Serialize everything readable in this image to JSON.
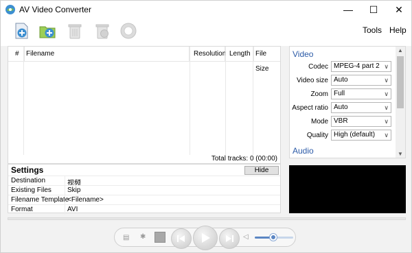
{
  "window": {
    "title": "AV Video Converter"
  },
  "menu": {
    "tools": "Tools",
    "help": "Help"
  },
  "toolbar": {
    "add_file": "add-file",
    "add_folder": "add-folder",
    "remove": "remove",
    "clear": "clear",
    "convert": "convert"
  },
  "filelist": {
    "columns": [
      "#",
      "Filename",
      "Resolution",
      "Length",
      "File Size"
    ],
    "total": "Total tracks: 0 (00:00)"
  },
  "settings": {
    "title": "Settings",
    "hide_label": "Hide",
    "rows": [
      {
        "key": "Destination",
        "value": "视频"
      },
      {
        "key": "Existing Files",
        "value": "Skip"
      },
      {
        "key": "Filename Template",
        "value": "<Filename>"
      },
      {
        "key": "Format",
        "value": "AVI"
      }
    ]
  },
  "video": {
    "title": "Video",
    "fields": [
      {
        "label": "Codec",
        "value": "MPEG-4 part 2"
      },
      {
        "label": "Video size",
        "value": "Auto"
      },
      {
        "label": "Zoom",
        "value": "Full"
      },
      {
        "label": "Aspect ratio",
        "value": "Auto"
      },
      {
        "label": "Mode",
        "value": "VBR"
      },
      {
        "label": "Quality",
        "value": "High (default)"
      }
    ]
  },
  "audio": {
    "title": "Audio"
  },
  "playback": {
    "volume": 0.5
  },
  "colors": {
    "accent": "#2b5aa7",
    "preview": "#000000",
    "volume": "#5b86c3"
  }
}
